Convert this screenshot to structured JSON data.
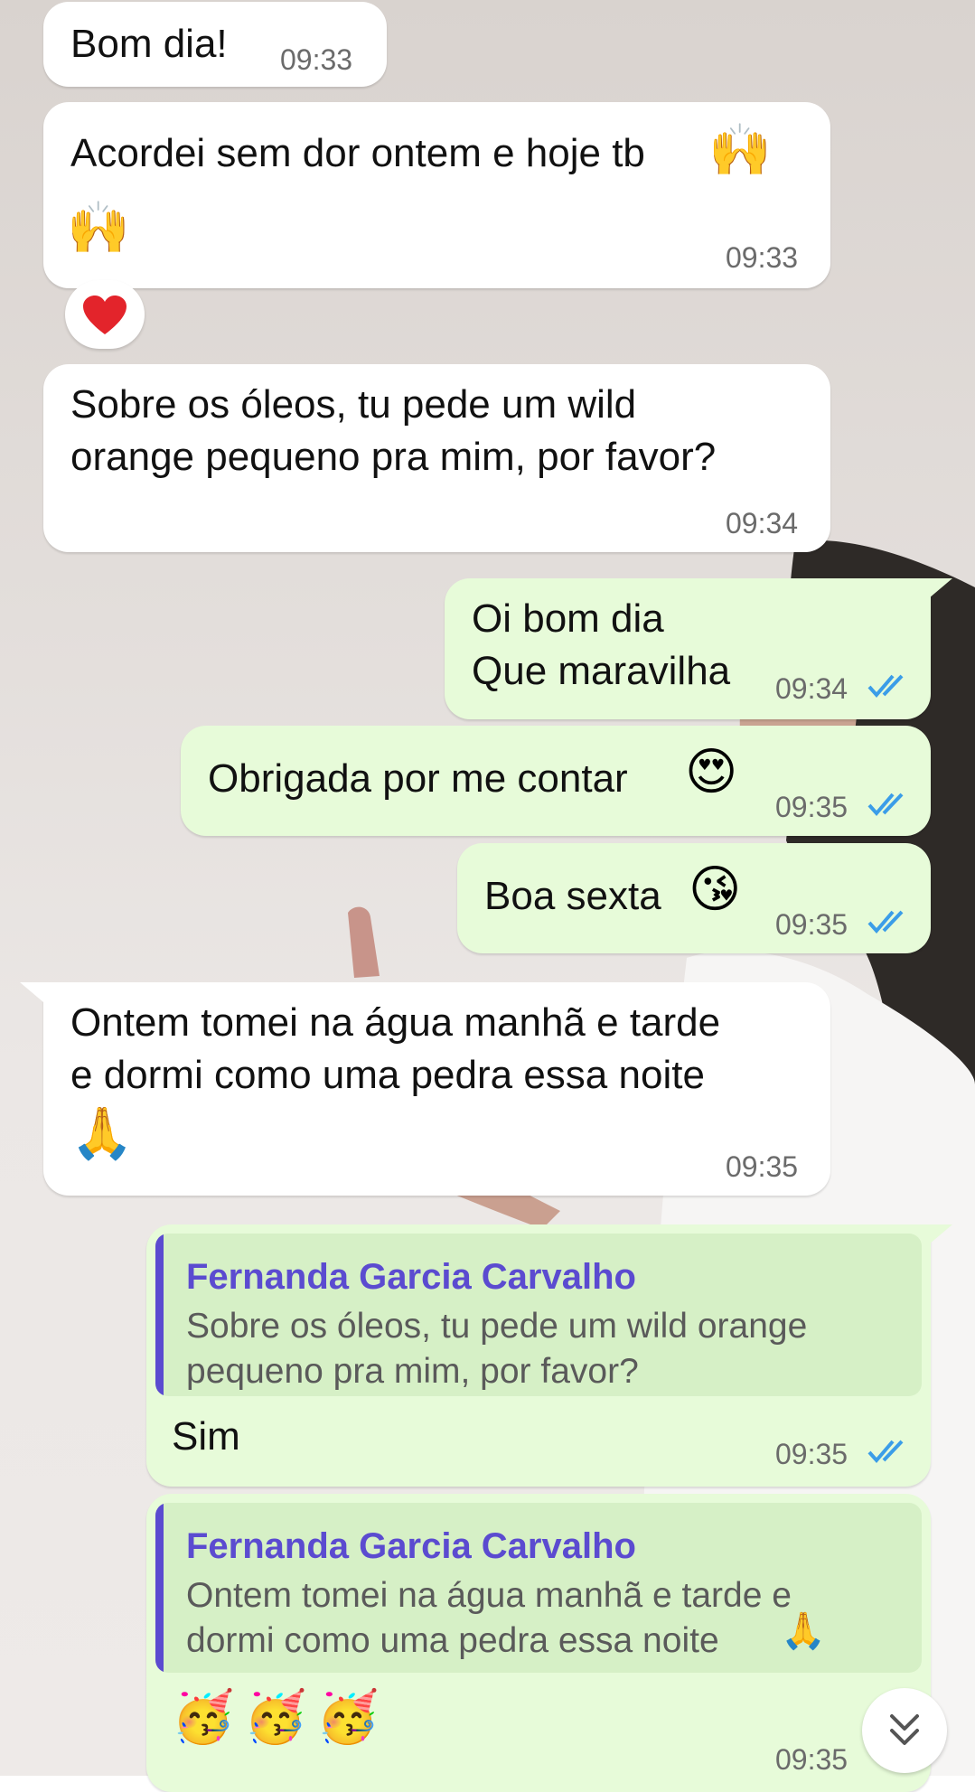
{
  "colors": {
    "incoming_bubble": "#ffffff",
    "outgoing_bubble": "#e7fbd9",
    "quote_accent": "#5b4bd0",
    "read_ticks": "#3b9de8"
  },
  "messages": [
    {
      "dir": "in",
      "text": "Bom dia!",
      "time": "09:33"
    },
    {
      "dir": "in",
      "text": "Acordei sem dor ontem e hoje tb",
      "time": "09:33",
      "emojis": [
        "raising-hands-emoji",
        "raising-hands-emoji"
      ]
    },
    {
      "dir": "in",
      "text": "Sobre os óleos, tu pede um wild\norange pequeno pra mim, por favor?",
      "time": "09:34"
    },
    {
      "dir": "out",
      "text": "Oi bom dia\nQue maravilha",
      "time": "09:34",
      "status": "read"
    },
    {
      "dir": "out",
      "text": "Obrigada por me contar",
      "time": "09:35",
      "status": "read",
      "emojis": [
        "heart-eyes-emoji"
      ]
    },
    {
      "dir": "out",
      "text": "Boa sexta",
      "time": "09:35",
      "status": "read",
      "emojis": [
        "kissing-face-emoji"
      ]
    },
    {
      "dir": "in",
      "text": "Ontem tomei na água manhã e tarde\ne dormi como uma pedra essa noite",
      "time": "09:35",
      "emojis": [
        "folded-hands-emoji"
      ]
    },
    {
      "dir": "out",
      "text": "Sim",
      "time": "09:35",
      "status": "read",
      "quote": {
        "author": "Fernanda Garcia Carvalho",
        "text": "Sobre os óleos, tu pede um wild orange\npequeno pra mim, por favor?"
      }
    },
    {
      "dir": "out",
      "text": "",
      "time": "09:35",
      "status": "read",
      "emojis": [
        "partying-face-emoji",
        "partying-face-emoji",
        "partying-face-emoji"
      ],
      "quote": {
        "author": "Fernanda Garcia Carvalho",
        "text": "Ontem tomei na água manhã e tarde e\ndormi como uma pedra essa noite"
      }
    }
  ],
  "reaction": {
    "emoji": "red-heart-emoji",
    "on_message": 2
  },
  "scroll_down_button": {
    "icon": "double-chevron-down-icon"
  }
}
